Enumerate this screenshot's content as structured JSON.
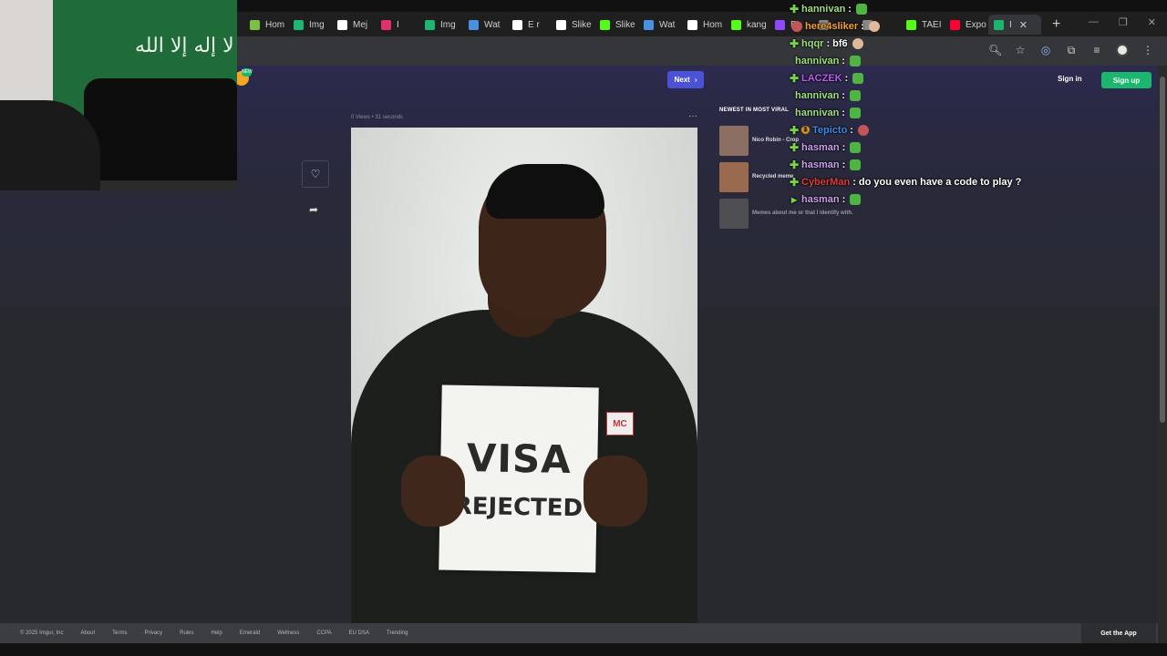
{
  "browser": {
    "tabs": [
      {
        "label": "Hom",
        "icon": "leaf-icon",
        "color": "#7bc043"
      },
      {
        "label": "Img",
        "icon": "imgur-icon",
        "color": "#1bb76e"
      },
      {
        "label": "Mej",
        "icon": "x-icon",
        "color": "#ffffff"
      },
      {
        "label": "I",
        "icon": "instagram-icon",
        "color": "#e1306c"
      },
      {
        "label": "Img",
        "icon": "imgur-icon",
        "color": "#1bb76e"
      },
      {
        "label": "Wat",
        "icon": "watch-icon",
        "color": "#4a90e2"
      },
      {
        "label": "E r",
        "icon": "x-icon",
        "color": "#ffffff"
      },
      {
        "label": "Slike",
        "icon": "tiktok-icon",
        "color": "#ffffff"
      },
      {
        "label": "Slike",
        "icon": "kick-icon",
        "color": "#53fc18"
      },
      {
        "label": "Wat",
        "icon": "watch-icon",
        "color": "#4a90e2"
      },
      {
        "label": "Hom",
        "icon": "x-icon",
        "color": "#ffffff"
      },
      {
        "label": "kang",
        "icon": "kick-icon",
        "color": "#53fc18"
      },
      {
        "label": "Re",
        "icon": "twitch-icon",
        "color": "#9146ff"
      },
      {
        "label": "",
        "icon": "tab-icon",
        "color": "#888888"
      },
      {
        "label": "",
        "icon": "tab-icon",
        "color": "#888888"
      },
      {
        "label": "TAEI",
        "icon": "kick-icon",
        "color": "#53fc18"
      },
      {
        "label": "Expo",
        "icon": "youtube-icon",
        "color": "#ff0033"
      },
      {
        "label": "I",
        "icon": "imgur-icon",
        "color": "#1bb76e",
        "active": true
      }
    ],
    "new_tab": "+"
  },
  "header": {
    "next_label": "Next",
    "sign_in": "Sign in",
    "sign_up": "Sign up",
    "badge": "NEW"
  },
  "post": {
    "views": "0 Views",
    "separator": "•",
    "age": "31 seconds",
    "more": "···",
    "sign_line1": "VISA",
    "sign_line2": "REJECTED",
    "shirt_logo": "MC"
  },
  "sidebar": {
    "heading": "NEWEST IN MOST VIRAL",
    "items": [
      {
        "title": "Nico Robin - Crop"
      },
      {
        "title": "Recycled meme"
      },
      {
        "title": "Memes about me or that I identify with."
      }
    ]
  },
  "footer": {
    "links": [
      "© 2025 Imgur, Inc",
      "About",
      "Terms",
      "Privacy",
      "Rules",
      "Help",
      "Emerald",
      "Wellness",
      "CCPA",
      "EU DSA",
      "Trending"
    ],
    "get_app": "Get the App"
  },
  "webcam": {
    "flag_text": "لا إله إلا الله"
  },
  "chat": {
    "messages": [
      {
        "user": "hannivan",
        "color": "#9ee07a",
        "text": "",
        "emote": "green",
        "badge": "plus"
      },
      {
        "user": "here4sliker",
        "color": "#f0a030",
        "text": "",
        "emote": "face",
        "badge": "red"
      },
      {
        "user": "hqqr",
        "color": "#9ee07a",
        "text": "bf6",
        "emote": "face",
        "badge": "plus"
      },
      {
        "user": "hannivan",
        "color": "#9ee07a",
        "text": "",
        "emote": "green",
        "badge": "none"
      },
      {
        "user": "LACZEK",
        "color": "#b65ee8",
        "text": "",
        "emote": "green",
        "badge": "plus"
      },
      {
        "user": "hannivan",
        "color": "#9ee07a",
        "text": "",
        "emote": "green",
        "badge": "none"
      },
      {
        "user": "hannivan",
        "color": "#9ee07a",
        "text": "",
        "emote": "green",
        "badge": "none"
      },
      {
        "user": "Tepicto",
        "color": "#3b8de0",
        "text": "",
        "emote": "red",
        "badge": "gold"
      },
      {
        "user": "hasman",
        "color": "#c9a0e8",
        "text": "",
        "emote": "green",
        "badge": "plus"
      },
      {
        "user": "hasman",
        "color": "#c9a0e8",
        "text": "",
        "emote": "green",
        "badge": "plus"
      },
      {
        "user": "CyberMan",
        "color": "#e03a3a",
        "text": "do you even have a code to play ?",
        "emote": "",
        "badge": "plus"
      },
      {
        "user": "hasman",
        "color": "#c9a0e8",
        "text": "",
        "emote": "green",
        "badge": "arrow"
      }
    ]
  }
}
